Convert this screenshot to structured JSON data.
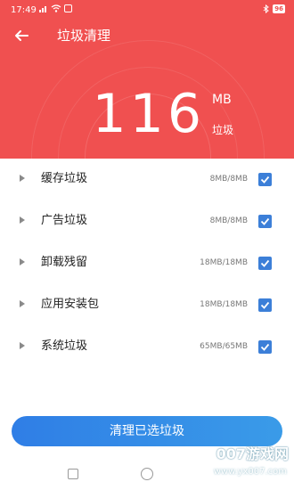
{
  "status_bar": {
    "time": "17:49",
    "battery": "96"
  },
  "header": {
    "title": "垃圾清理",
    "total_value": "116",
    "total_unit": "MB",
    "total_label": "垃圾"
  },
  "items": [
    {
      "label": "缓存垃圾",
      "size": "8MB/8MB",
      "checked": true
    },
    {
      "label": "广告垃圾",
      "size": "8MB/8MB",
      "checked": true
    },
    {
      "label": "卸载残留",
      "size": "18MB/18MB",
      "checked": true
    },
    {
      "label": "应用安装包",
      "size": "18MB/18MB",
      "checked": true
    },
    {
      "label": "系统垃圾",
      "size": "65MB/65MB",
      "checked": true
    }
  ],
  "clean_button": {
    "label": "清理已选垃圾"
  },
  "watermark": {
    "text": "007游戏网",
    "url": "www.yx007.com"
  },
  "colors": {
    "header": "#f05050",
    "accent": "#3c7fd8"
  }
}
